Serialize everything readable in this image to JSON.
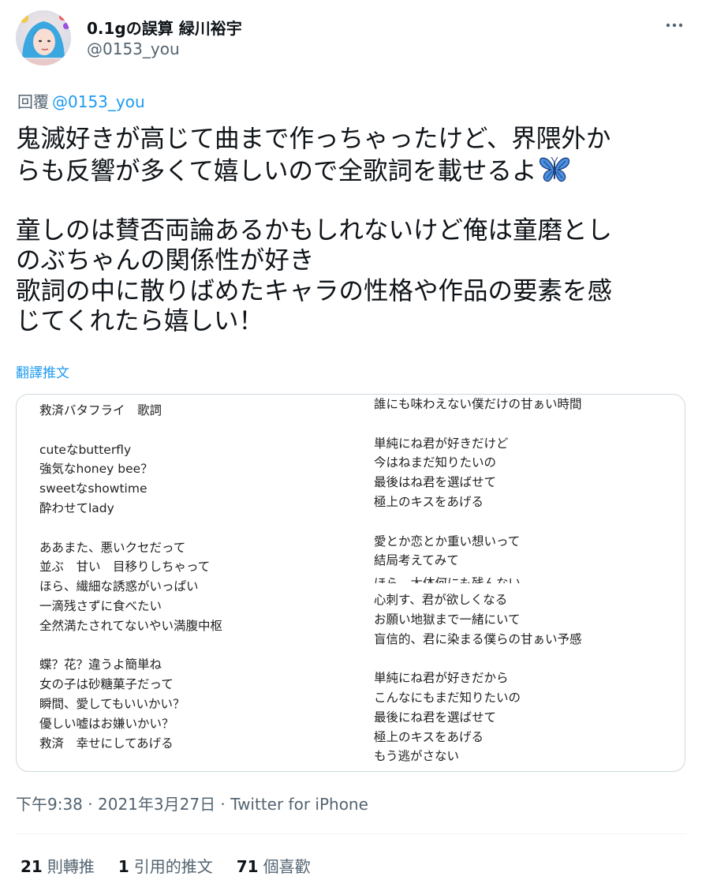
{
  "user": {
    "display_name": "0.1gの誤算 緑川裕宇",
    "handle": "@0153_you"
  },
  "reply": {
    "prefix": "回覆",
    "mention": "@0153_you"
  },
  "tweet": {
    "lines_p1": [
      "鬼滅好きが高じて曲まで作っちゃったけど、界隈外か",
      "らも反響が多くて嬉しいので全歌詞を載せるよ"
    ],
    "lines_p2": [
      "童しのは賛否両論あるかもしれないけど俺は童磨とし",
      "のぶちゃんの関係性が好き",
      "歌詞の中に散りばめたキャラの性格や作品の要素を感",
      "じてくれたら嬉しい！"
    ],
    "emoji_icon": "butterfly-icon"
  },
  "translate_label": "翻譯推文",
  "lyrics": {
    "left_col": [
      "救済バタフライ　歌詞",
      "",
      "cuteなbutterfly",
      "強気なhoney bee？",
      "sweetなshowtime",
      "酔わせてlady",
      "",
      "ああまた、悪いクセだって",
      "並ぶ　甘い　目移りしちゃって",
      "ほら、繊細な誘惑がいっぱい",
      "一滴残さずに食べたい",
      "全然満たされてないやい満腹中枢",
      "",
      "蝶？花？違うよ簡単ね",
      "女の子は砂糖菓子だって",
      "瞬間、愛してもいいかい？",
      "優しい嘘はお嫌いかい？",
      "救済　幸せにしてあげる"
    ],
    "right_col_a": [
      "誰にも味わえない僕だけの甘ぁい時間",
      "",
      "単純にね君が好きだけど",
      "今はねまだ知りたいの",
      "最後はね君を選ばせて",
      "極上のキスをあげる",
      "",
      "愛とか恋とか重い想いって",
      "結局考えてみて"
    ],
    "right_garbled": "ほら、太体何にも残んない",
    "right_col_b": [
      "心刺す、君が欲しくなる",
      "お願い地獄まで一緒にいて",
      "盲信的、君に染まる僕らの甘ぁい予感",
      "",
      "単純にね君が好きだから",
      "こんなにもまだ知りたいの",
      "最後にね君を選ばせて",
      "極上のキスをあげる",
      "もう逃がさない"
    ]
  },
  "meta": {
    "time": "下午9:38",
    "separator": " · ",
    "date": "2021年3月27日",
    "source": "Twitter for iPhone"
  },
  "stats": [
    {
      "num": "21",
      "label": "則轉推"
    },
    {
      "num": "1",
      "label": "引用的推文"
    },
    {
      "num": "71",
      "label": "個喜歡"
    }
  ],
  "colors": {
    "accent": "#1d9bf0",
    "secondary_text": "#536471",
    "primary_text": "#0f1419",
    "butterfly": "#4a90e2"
  }
}
